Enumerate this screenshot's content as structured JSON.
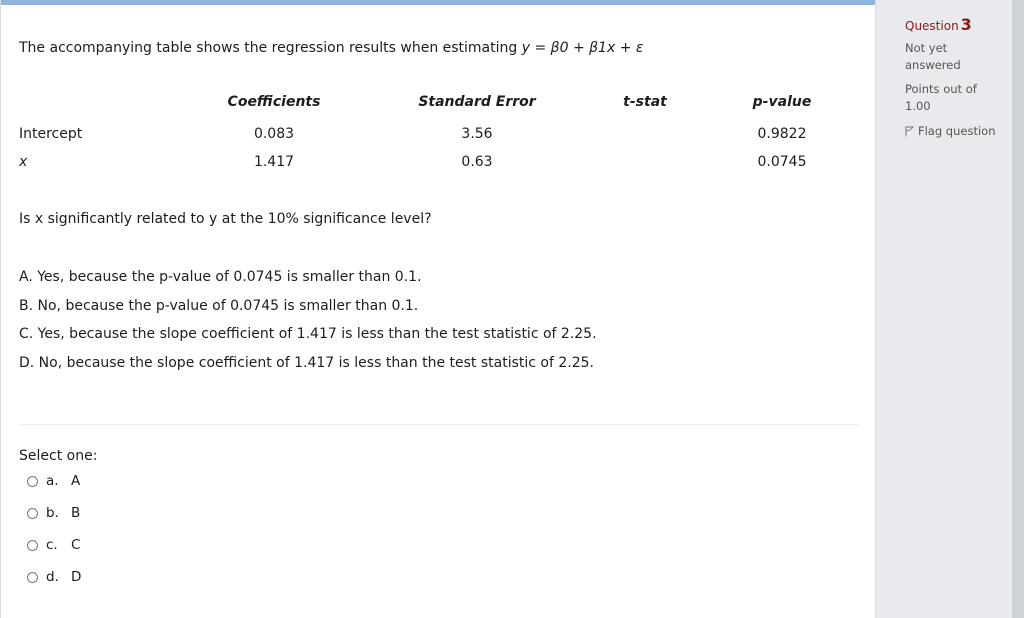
{
  "question": {
    "intro_text": "The accompanying table shows the regression results when estimating ",
    "equation": "y = β0 + β1x + ε",
    "table": {
      "headers": [
        "Coefficients",
        "Standard Error",
        "t-stat",
        "p-value"
      ],
      "rows": [
        {
          "label": "Intercept",
          "coefficient": "0.083",
          "std_error": "3.56",
          "t_stat": "",
          "p_value": "0.9822"
        },
        {
          "label": "x",
          "coefficient": "1.417",
          "std_error": "0.63",
          "t_stat": "",
          "p_value": "0.0745"
        }
      ]
    },
    "prompt": "Is x significantly related to y at the 10% significance level?",
    "choices": [
      "A. Yes, because the p-value of 0.0745 is smaller than 0.1.",
      "B. No, because the p-value of 0.0745 is smaller than 0.1.",
      "C. Yes, because the slope coefficient of 1.417 is less than the test statistic of 2.25.",
      "D. No, because the slope coefficient of 1.417 is less than the test statistic of 2.25."
    ]
  },
  "answer": {
    "select_label": "Select one:",
    "options": [
      {
        "letter": "a.",
        "text": "A",
        "selected": false
      },
      {
        "letter": "b.",
        "text": "B",
        "selected": false
      },
      {
        "letter": "c.",
        "text": "C",
        "selected": false
      },
      {
        "letter": "d.",
        "text": "D",
        "selected": false
      }
    ]
  },
  "sidebar": {
    "question_word": "Question",
    "question_number": "3",
    "status_line1": "Not yet",
    "status_line2": "answered",
    "points_line1": "Points out of",
    "points_line2": "1.00",
    "flag_label": "Flag question",
    "flag_icon": "flag-icon"
  },
  "colors": {
    "top_bar": "#8fb5dc",
    "question_label": "#8b1a1a",
    "sidebar_bg": "#e9eaed"
  }
}
